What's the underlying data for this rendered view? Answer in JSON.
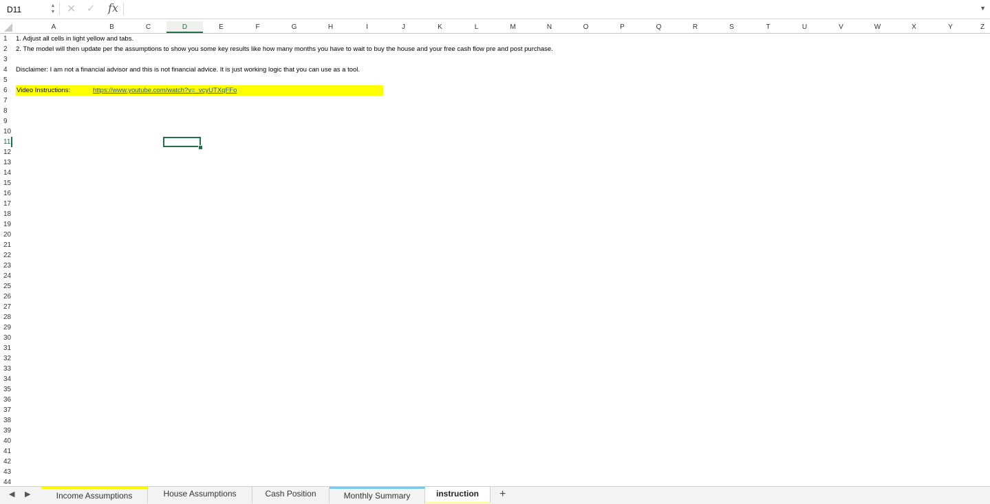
{
  "formula_bar": {
    "cell_ref": "D11",
    "fx_label": "fx",
    "formula": ""
  },
  "columns": [
    "A",
    "B",
    "C",
    "D",
    "E",
    "F",
    "G",
    "H",
    "I",
    "J",
    "K",
    "L",
    "M",
    "N",
    "O",
    "P",
    "Q",
    "R",
    "S",
    "T",
    "U",
    "V",
    "W",
    "X",
    "Y",
    "Z"
  ],
  "selected_column": "D",
  "rows": [
    1,
    2,
    3,
    4,
    5,
    6,
    7,
    8,
    9,
    10,
    11,
    12,
    13,
    14,
    15,
    16,
    17,
    18,
    19,
    20,
    21,
    22,
    23,
    24,
    25,
    26,
    27,
    28,
    29,
    30,
    31,
    32,
    33,
    34,
    35,
    36,
    37,
    38,
    39,
    40,
    41,
    42,
    43,
    44
  ],
  "selected_row": 11,
  "cells": {
    "a1": "1. Adjust all cells in light yellow and tabs.",
    "a2": "2. The model will then update per the assumptions to show you some key results like how many months you have to wait to buy the house and your free cash flow pre and post purchase.",
    "a4": "Disclaimer: I am not a financial advisor and this is not financial advice. It is just working logic that you can use as a tool.",
    "a6": "Video Instructions:",
    "b6": "https://www.youtube.com/watch?v=_vcyUTXqFFo"
  },
  "colors": {
    "input_highlight": "#ffff00",
    "selection_green": "#1f7246",
    "link_blue": "#1155cc"
  },
  "sheet_tabs": [
    {
      "label": "Income Assumptions",
      "color": "#ffff00",
      "active": false
    },
    {
      "label": "House Assumptions",
      "color": "",
      "active": false
    },
    {
      "label": "Cash Position",
      "color": "",
      "active": false
    },
    {
      "label": "Monthly Summary",
      "color": "#7cc6f0",
      "active": false
    },
    {
      "label": "instruction",
      "color": "#ffff99",
      "active": true
    }
  ],
  "add_sheet_label": "+"
}
